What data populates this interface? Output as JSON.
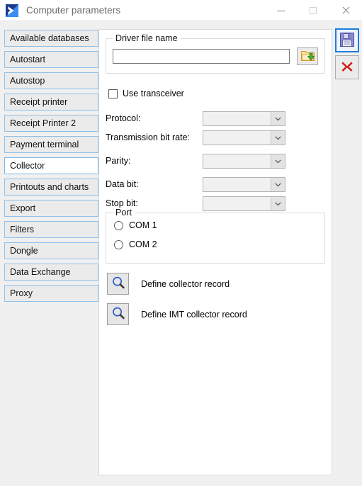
{
  "window": {
    "title": "Computer parameters",
    "icon": "app-chevron-icon",
    "controls": {
      "minimize": "minimize-icon",
      "maximize": "maximize-icon",
      "close": "close-icon"
    }
  },
  "sidebar": {
    "items": [
      {
        "label": "Available databases",
        "selected": false
      },
      {
        "label": "Autostart",
        "selected": false
      },
      {
        "label": "Autostop",
        "selected": false
      },
      {
        "label": "Receipt printer",
        "selected": false
      },
      {
        "label": "Receipt Printer 2",
        "selected": false
      },
      {
        "label": "Payment terminal",
        "selected": false
      },
      {
        "label": "Collector",
        "selected": true
      },
      {
        "label": "Printouts and charts",
        "selected": false
      },
      {
        "label": "Export",
        "selected": false
      },
      {
        "label": "Filters",
        "selected": false
      },
      {
        "label": "Dongle",
        "selected": false
      },
      {
        "label": "Data Exchange",
        "selected": false
      },
      {
        "label": "Proxy",
        "selected": false
      }
    ]
  },
  "main": {
    "driver_group": {
      "title": "Driver file name",
      "input_value": "",
      "input_placeholder": "",
      "browse_icon": "folder-open-icon"
    },
    "use_transceiver": {
      "label": "Use transceiver",
      "checked": false
    },
    "combos": [
      {
        "label": "Protocol:",
        "value": "",
        "enabled": false
      },
      {
        "label": "Transmission bit rate:",
        "value": "",
        "enabled": false
      },
      {
        "label": "Parity:",
        "value": "",
        "enabled": false
      },
      {
        "label": "Data bit:",
        "value": "",
        "enabled": false
      },
      {
        "label": "Stop bit:",
        "value": "",
        "enabled": false
      }
    ],
    "port_group": {
      "title": "Port",
      "options": [
        {
          "label": "COM 1",
          "selected": false
        },
        {
          "label": "COM 2",
          "selected": false
        }
      ]
    },
    "actions": [
      {
        "label": "Define collector record",
        "icon": "magnifier-icon"
      },
      {
        "label": "Define IMT collector record",
        "icon": "magnifier-icon"
      }
    ]
  },
  "toolbar": {
    "save": {
      "label": "Save",
      "icon": "floppy-disk-icon",
      "focused": true
    },
    "cancel": {
      "label": "Cancel",
      "icon": "red-x-icon",
      "focused": false
    }
  },
  "colors": {
    "accent_blue": "#1a7fdd",
    "tab_border": "#8fbfe8",
    "window_bg": "#f0f0f0",
    "panel_bg": "#ffffff",
    "cancel_red": "#d82020",
    "folder_orange": "#f0a830",
    "arrow_green": "#39a02c"
  }
}
